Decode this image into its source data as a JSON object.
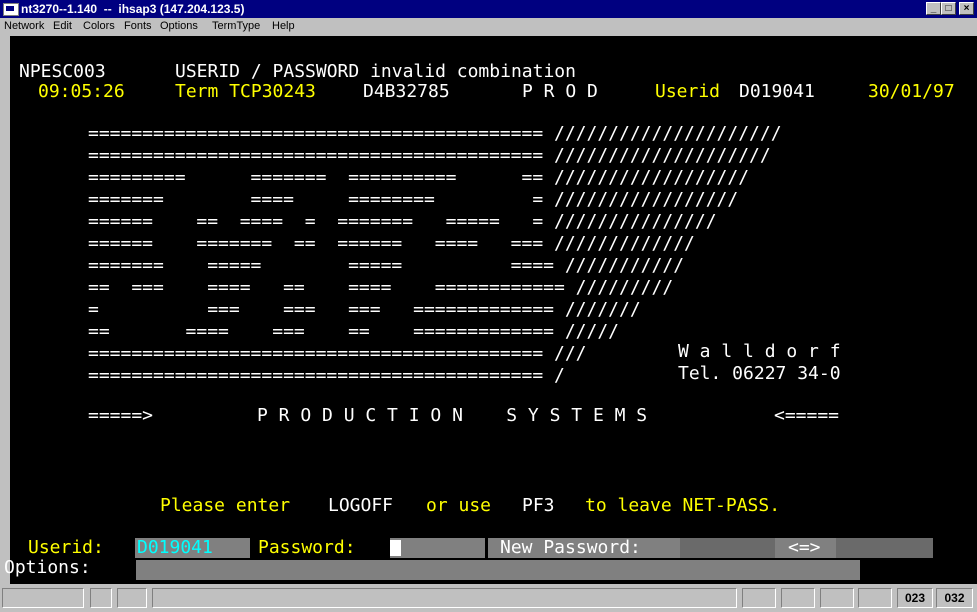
{
  "window": {
    "title": "nt3270--1.140  --  ihsap3 (147.204.123.5)"
  },
  "window_controls": {
    "minimize": "_",
    "maximize": "□",
    "close": "×"
  },
  "menu": [
    "Network",
    "Edit",
    "Colors",
    "Fonts",
    "Options",
    "TermType",
    "Help"
  ],
  "screen": {
    "program": "NPESC003",
    "message": "USERID / PASSWORD invalid combination",
    "time": "09:05:26",
    "term": "Term TCP30243",
    "terminal_id": "D4B32785",
    "environment": "P R O D",
    "userid_label": "Userid",
    "userid_value": "D019041",
    "date": "30/01/97",
    "art_lines": [
      "========================================== /////////////////////",
      "========================================== ////////////////////",
      "=========      =======  ==========      == //////////////////",
      "=======        ====     ========         = /////////////////",
      "======    ==  ====  =  =======   =====   = ///////////////",
      "======    =======  ==  ======   ====   === /////////////",
      "=======    =====        =====          ==== ///////////",
      "==  ===    ====   ==    ====    ============ /////////",
      "=          ===    ===   ===   ============= ///////",
      "==       ====    ===    ==    ============= /////",
      "========================================== ///",
      "========================================== /"
    ],
    "location": "W a l l d o r f",
    "phone": "Tel. 06227 34-0",
    "arrow_left": "=====>",
    "banner": "P R O D U C T I O N    S Y S T E M S",
    "arrow_right": "<=====",
    "instruction": {
      "p1": "Please enter",
      "p2": "LOGOFF",
      "p3": "or use",
      "p4": "PF3",
      "p5": "to leave NET-PASS."
    },
    "form": {
      "userid_label": "Userid:",
      "userid_value": "D019041",
      "password_label": "Password:",
      "new_password_label": "New Password:",
      "swap": "<=>",
      "options_label": "Options:"
    }
  },
  "status": {
    "row": "023",
    "col": "032"
  }
}
